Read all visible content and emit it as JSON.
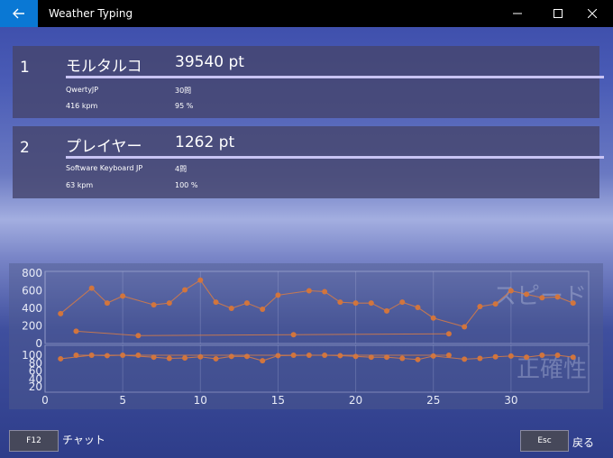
{
  "window": {
    "title": "Weather Typing"
  },
  "results": [
    {
      "rank": "1",
      "name": "モルタルコ",
      "score": "39540 pt",
      "keyboard": "QwertyJP",
      "questions": "30問",
      "kpm": "416 kpm",
      "accuracy": "95 %"
    },
    {
      "rank": "2",
      "name": "プレイヤー",
      "score": "1262 pt",
      "keyboard": "Software Keyboard JP",
      "questions": "4問",
      "kpm": "63 kpm",
      "accuracy": "100 %"
    }
  ],
  "chart_data": [
    {
      "type": "line",
      "title": "スピード",
      "ylim": [
        0,
        800
      ],
      "yticks": [
        0,
        200,
        400,
        600,
        800
      ],
      "series": [
        {
          "values": [
            [
              1,
              340
            ],
            [
              3,
              630
            ],
            [
              4,
              460
            ],
            [
              5,
              540
            ],
            [
              7,
              440
            ],
            [
              8,
              460
            ],
            [
              9,
              610
            ],
            [
              10,
              720
            ],
            [
              11,
              470
            ],
            [
              12,
              400
            ],
            [
              13,
              460
            ],
            [
              14,
              390
            ],
            [
              15,
              550
            ],
            [
              17,
              600
            ],
            [
              18,
              590
            ],
            [
              19,
              470
            ],
            [
              20,
              460
            ],
            [
              21,
              460
            ],
            [
              22,
              370
            ],
            [
              23,
              470
            ],
            [
              24,
              410
            ],
            [
              25,
              290
            ],
            [
              27,
              190
            ],
            [
              28,
              420
            ],
            [
              29,
              450
            ],
            [
              30,
              600
            ],
            [
              31,
              560
            ],
            [
              32,
              520
            ],
            [
              33,
              530
            ],
            [
              34,
              460
            ]
          ]
        },
        {
          "values": [
            [
              2,
              140
            ],
            [
              6,
              90
            ],
            [
              16,
              100
            ],
            [
              26,
              110
            ]
          ]
        }
      ]
    },
    {
      "type": "line",
      "title": "正確性",
      "ylim": [
        20,
        100
      ],
      "yticks": [
        20,
        40,
        60,
        80,
        100
      ],
      "xlim": [
        0,
        35
      ],
      "xticks": [
        0,
        5,
        10,
        15,
        20,
        25,
        30
      ],
      "series": [
        {
          "values": [
            [
              1,
              91
            ],
            [
              3,
              100
            ],
            [
              4,
              99
            ],
            [
              5,
              100
            ],
            [
              7,
              95
            ],
            [
              8,
              92
            ],
            [
              9,
              93
            ],
            [
              10,
              96
            ],
            [
              11,
              91
            ],
            [
              12,
              97
            ],
            [
              13,
              97
            ],
            [
              14,
              86
            ],
            [
              15,
              99
            ],
            [
              17,
              100
            ],
            [
              18,
              100
            ],
            [
              19,
              99
            ],
            [
              20,
              97
            ],
            [
              21,
              95
            ],
            [
              22,
              95
            ],
            [
              23,
              92
            ],
            [
              24,
              89
            ],
            [
              25,
              98
            ],
            [
              27,
              90
            ],
            [
              28,
              92
            ],
            [
              29,
              96
            ],
            [
              30,
              98
            ],
            [
              31,
              95
            ],
            [
              32,
              100
            ],
            [
              33,
              100
            ],
            [
              34,
              95
            ]
          ]
        },
        {
          "values": [
            [
              2,
              100
            ],
            [
              6,
              100
            ],
            [
              16,
              100
            ],
            [
              26,
              100
            ]
          ]
        }
      ]
    }
  ],
  "footer": {
    "chat_key": "F12",
    "chat_label": "チャット",
    "back_key": "Esc",
    "back_label": "戻る"
  },
  "colors": {
    "accent": "#0a78d4",
    "point": "#d2753d",
    "line": "#cf7a4a"
  }
}
